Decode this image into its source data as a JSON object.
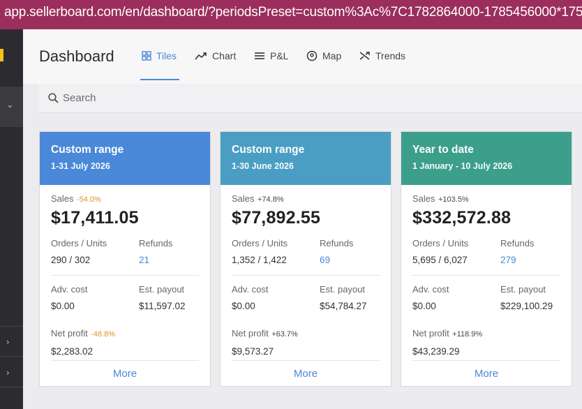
{
  "browser": {
    "url": "app.sellerboard.com/en/dashboard/?periodsPreset=custom%3Ac%7C1782864000-1785456000*1751328000-"
  },
  "header": {
    "title": "Dashboard",
    "tabs": [
      {
        "label": "Tiles",
        "icon": "tiles-icon",
        "active": true
      },
      {
        "label": "Chart",
        "icon": "chart-trend-icon"
      },
      {
        "label": "P&L",
        "icon": "list-icon"
      },
      {
        "label": "Map",
        "icon": "map-pin-icon"
      },
      {
        "label": "Trends",
        "icon": "shuffle-icon"
      }
    ]
  },
  "search": {
    "placeholder": "Search"
  },
  "colors": {
    "accent": "#4a88d8",
    "card1": "#4a88d8",
    "card2": "#4a9ec3",
    "card3": "#3b9f8c",
    "negative": "#e0922f"
  },
  "cards": [
    {
      "title": "Custom range",
      "range": "1-31 July 2026",
      "sales_label": "Sales",
      "sales_change": "-54.0%",
      "sales": "$17,411.05",
      "orders_label": "Orders / Units",
      "orders": "290 / 302",
      "refunds_label": "Refunds",
      "refunds": "21",
      "adv_label": "Adv. cost",
      "adv": "$0.00",
      "payout_label": "Est. payout",
      "payout": "$11,597.02",
      "net_label": "Net profit",
      "net_change": "-48.8%",
      "net": "$2,283.02",
      "more": "More"
    },
    {
      "title": "Custom range",
      "range": "1-30 June 2026",
      "sales_label": "Sales",
      "sales_change": "+74.8%",
      "sales": "$77,892.55",
      "orders_label": "Orders / Units",
      "orders": "1,352 / 1,422",
      "refunds_label": "Refunds",
      "refunds": "69",
      "adv_label": "Adv. cost",
      "adv": "$0.00",
      "payout_label": "Est. payout",
      "payout": "$54,784.27",
      "net_label": "Net profit",
      "net_change": "+63.7%",
      "net": "$9,573.27",
      "more": "More"
    },
    {
      "title": "Year to date",
      "range": "1 January - 10 July 2026",
      "sales_label": "Sales",
      "sales_change": "+103.5%",
      "sales": "$332,572.88",
      "orders_label": "Orders / Units",
      "orders": "5,695 / 6,027",
      "refunds_label": "Refunds",
      "refunds": "279",
      "adv_label": "Adv. cost",
      "adv": "$0.00",
      "payout_label": "Est. payout",
      "payout": "$229,100.29",
      "net_label": "Net profit",
      "net_change": "+118.9%",
      "net": "$43,239.29",
      "more": "More"
    }
  ]
}
